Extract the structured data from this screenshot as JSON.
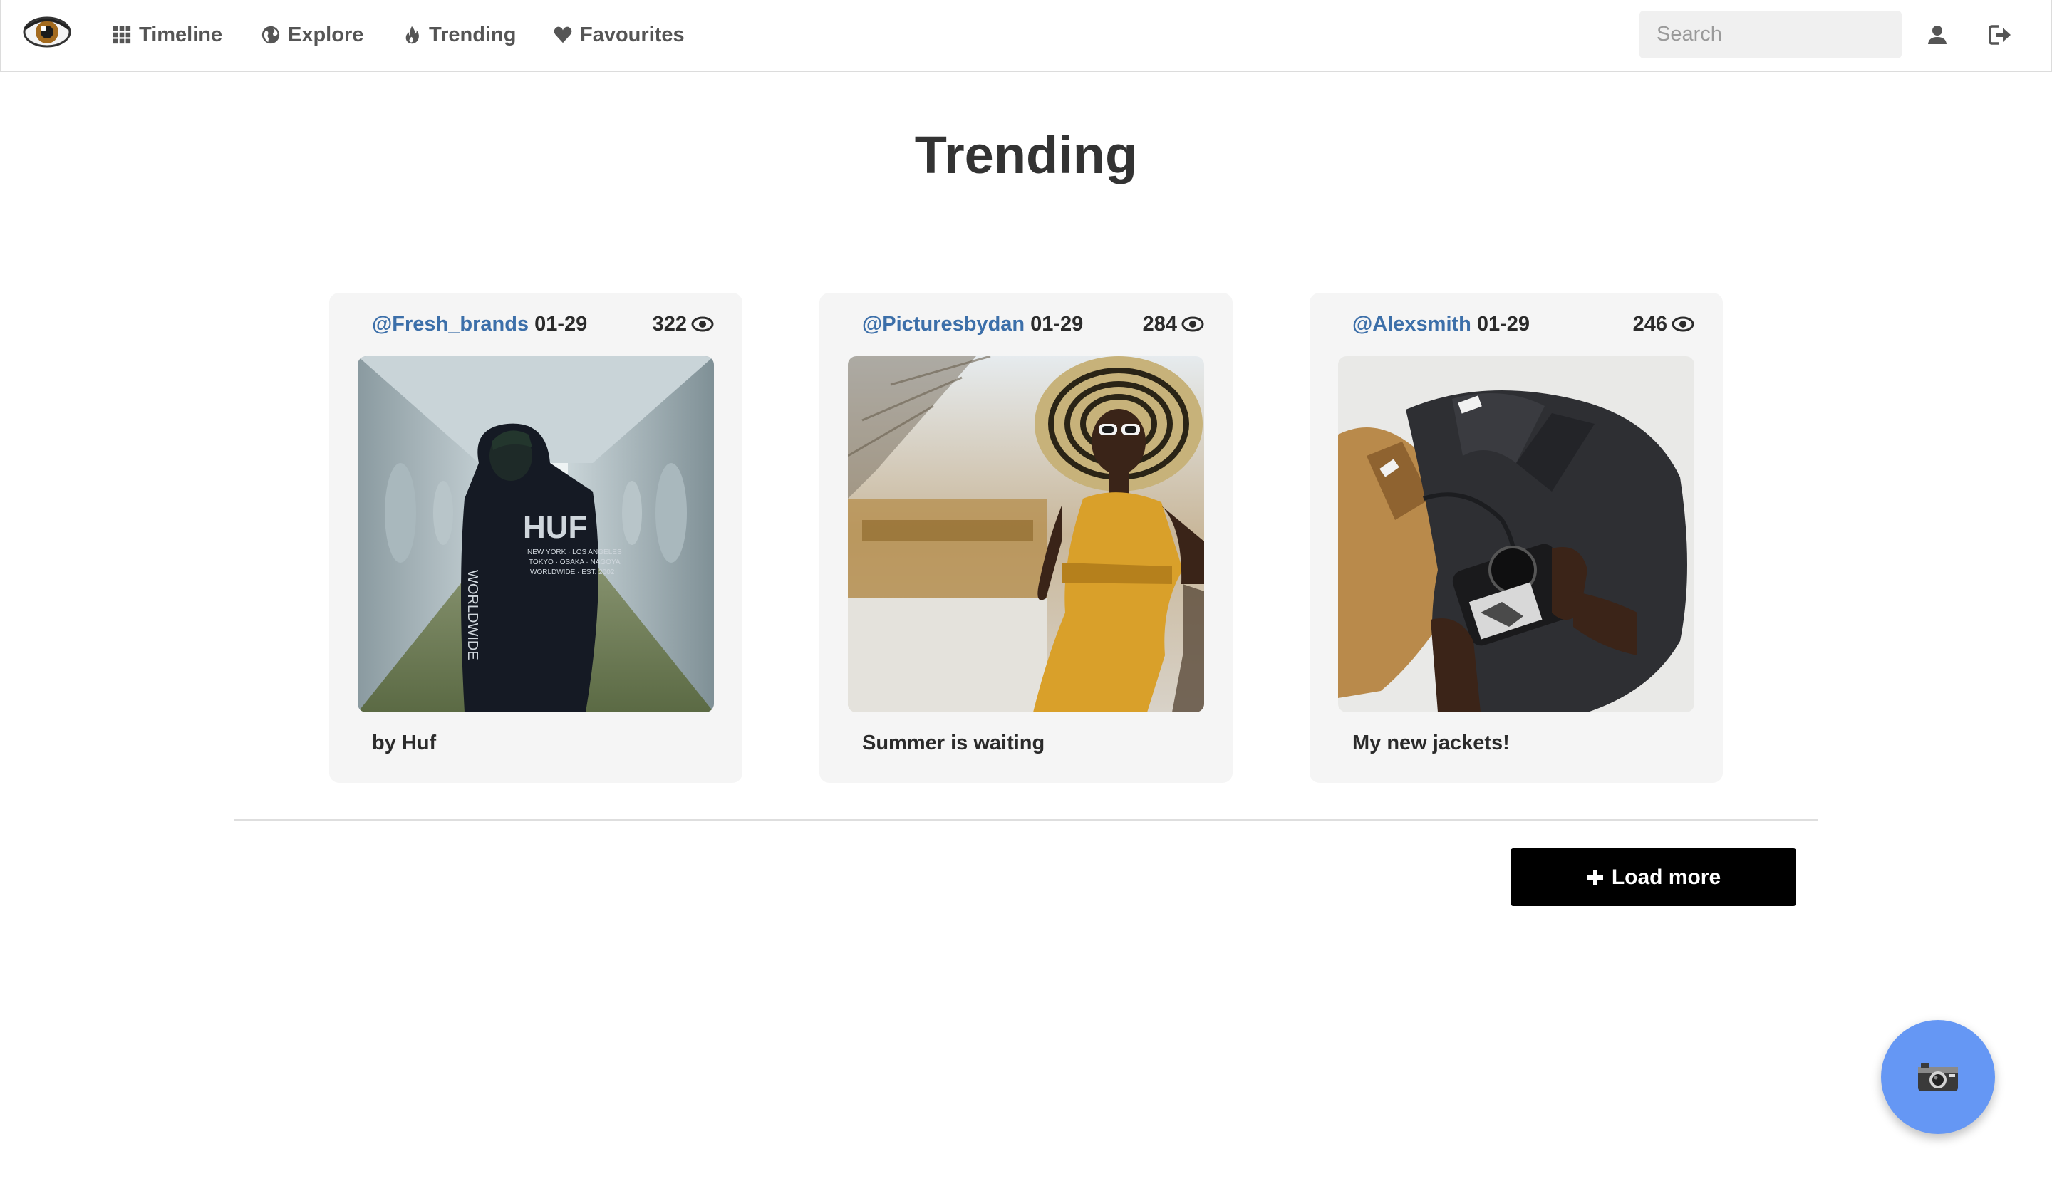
{
  "nav": {
    "items": [
      {
        "label": "Timeline",
        "icon": "grid-icon"
      },
      {
        "label": "Explore",
        "icon": "globe-icon"
      },
      {
        "label": "Trending",
        "icon": "flame-icon"
      },
      {
        "label": "Favourites",
        "icon": "heart-icon"
      }
    ],
    "search_placeholder": "Search",
    "logo_icon": "eye-logo-icon",
    "user_icon": "user-icon",
    "logout_icon": "logout-icon"
  },
  "page": {
    "title": "Trending"
  },
  "posts": [
    {
      "user": "@Fresh_brands",
      "date": "01-29",
      "views": "322",
      "caption": "by Huf",
      "photo": "man in black HUF hoodie in a corridor"
    },
    {
      "user": "@Picturesbydan",
      "date": "01-29",
      "views": "284",
      "caption": "Summer is waiting",
      "photo": "woman in yellow jumpsuit and striped sun hat"
    },
    {
      "user": "@Alexsmith",
      "date": "01-29",
      "views": "246",
      "caption": "My new jackets!",
      "photo": "jackets on bed with camera in hands"
    }
  ],
  "actions": {
    "load_more": "Load more",
    "fab_icon": "camera-icon"
  },
  "colors": {
    "accent_link": "#3c6fa9",
    "fab": "#6597f4",
    "button": "#000000",
    "card_bg": "#f5f5f5"
  }
}
